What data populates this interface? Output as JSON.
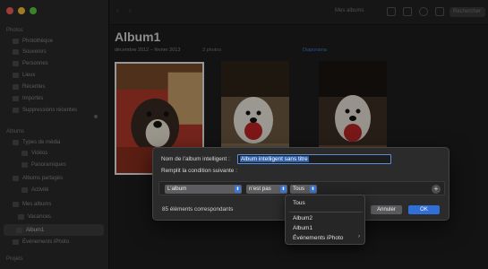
{
  "window": {
    "toolbar": {
      "title": "Mes albums",
      "search_placeholder": "Rechercher"
    }
  },
  "sidebar": {
    "sections": [
      {
        "label": "Photos"
      },
      {
        "label": "Albums"
      },
      {
        "label": "Projets"
      }
    ],
    "items": [
      {
        "label": "Photothèque"
      },
      {
        "label": "Souvenirs"
      },
      {
        "label": "Personnes"
      },
      {
        "label": "Lieux"
      },
      {
        "label": "Récentes"
      },
      {
        "label": "Importés"
      },
      {
        "label": "Suppressions récentes"
      },
      {
        "label": "Types de média"
      },
      {
        "label": "Vidéos"
      },
      {
        "label": "Panoramiques"
      },
      {
        "label": "Albums partagés"
      },
      {
        "label": "Activité"
      },
      {
        "label": "Mes albums"
      },
      {
        "label": "Vacances"
      },
      {
        "label": "Album1"
      },
      {
        "label": "Événements iPhoto"
      }
    ]
  },
  "main": {
    "title": "Album1",
    "date_range": "décembre 2012 – février 2013",
    "count": "3 photos",
    "slideshow": "Diaporama"
  },
  "dialog": {
    "name_label": "Nom de l’album intelligent :",
    "name_value": "Album intelligent sans titre",
    "condition_label": "Remplit la condition suivante :",
    "field_popup": "L’album",
    "operator_popup": "n’est pas",
    "value_popup": "Tous",
    "add_symbol": "+",
    "match_count": "85 éléments correspondants",
    "cancel_label": "Annuler",
    "ok_label": "OK"
  },
  "menu": {
    "items": [
      {
        "label": "Tous"
      },
      {
        "label": "Album2"
      },
      {
        "label": "Album1"
      },
      {
        "label": "Événements iPhoto"
      }
    ],
    "submenu_arrow": "›"
  },
  "colors": {
    "accent": "#2f6fd6",
    "sidebar_bg": "#2a2a2a",
    "dialog_bg": "#2b2b2c"
  }
}
